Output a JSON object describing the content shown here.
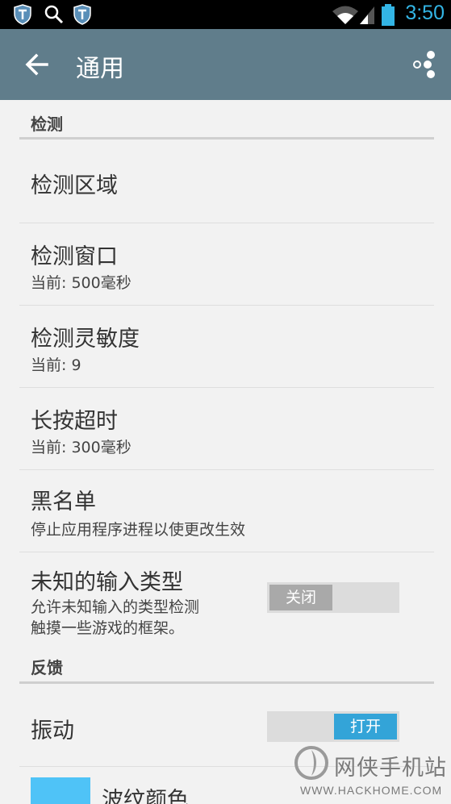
{
  "status_bar": {
    "time": "3:50",
    "time_color": "#33b5e5"
  },
  "action_bar": {
    "title": "通用",
    "background": "#607d8b"
  },
  "sections": {
    "detection": {
      "header": "检测",
      "items": [
        {
          "title": "检测区域",
          "summary": ""
        },
        {
          "title": "检测窗口",
          "summary": "当前: 500毫秒"
        },
        {
          "title": "检测灵敏度",
          "summary": "当前: 9"
        },
        {
          "title": "长按超时",
          "summary": "当前: 300毫秒"
        },
        {
          "title": "黑名单",
          "summary": "停止应用程序进程以使更改生效"
        },
        {
          "title": "未知的输入类型",
          "summary_line1": "允许未知输入的类型检测",
          "summary_line2": "触摸一些游戏的框架。",
          "switch_label": "关闭",
          "switch_state": "off"
        }
      ]
    },
    "feedback": {
      "header": "反馈",
      "items": [
        {
          "title": "振动",
          "switch_label": "打开",
          "switch_state": "on"
        },
        {
          "title": "波纹颜色",
          "swatch_color": "#4fc3f7"
        }
      ]
    }
  },
  "watermark": {
    "name": "网侠手机站",
    "url": "WWW.HACKHOME.COM"
  }
}
